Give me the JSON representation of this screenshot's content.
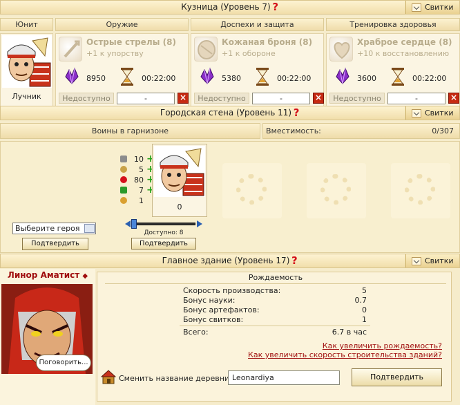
{
  "smithy": {
    "title": "Кузница (Уровень 7)",
    "scrolls": "Свитки",
    "columns": {
      "unit": "Юнит",
      "weapons": "Оружие",
      "armor": "Доспехи и защита",
      "health": "Тренировка здоровья"
    },
    "unit_name": "Лучник",
    "cards": [
      {
        "name": "Острые стрелы (8)",
        "desc": "+1 к упорству",
        "cost": "8950",
        "time": "00:22:00",
        "status": "Недоступно",
        "select": "-"
      },
      {
        "name": "Кожаная броня (8)",
        "desc": "+1 к обороне",
        "cost": "5380",
        "time": "00:22:00",
        "status": "Недоступно",
        "select": "-"
      },
      {
        "name": "Храброе сердце (8)",
        "desc": "+10 к восстановлению",
        "cost": "3600",
        "time": "00:22:00",
        "status": "Недоступно",
        "select": "-"
      }
    ]
  },
  "wall": {
    "title": "Городская стена (Уровень 11)",
    "scrolls": "Свитки",
    "garrison": "Воины в гарнизоне",
    "capacity_label": "Вместимость:",
    "capacity": "0/307",
    "stats": [
      "10",
      "5",
      "80",
      "7",
      "1"
    ],
    "unit_count": "0",
    "hero_select": "Выберите героя",
    "confirm": "Подтвердить",
    "available": "Доступно: 8",
    "confirm2": "Подтвердить"
  },
  "main": {
    "title": "Главное здание (Уровень 17)",
    "scrolls": "Свитки",
    "governor": "Линор Аматист",
    "talk": "Поговорить...",
    "birth_title": "Рождаемость",
    "rows": [
      {
        "k": "Скорость производства:",
        "v": "5"
      },
      {
        "k": "Бонус науки:",
        "v": "0.7"
      },
      {
        "k": "Бонус артефактов:",
        "v": "0"
      },
      {
        "k": "Бонус свитков:",
        "v": "1"
      }
    ],
    "total_label": "Всего:",
    "total": "6.7 в час",
    "link1": "Как увеличить рождаемость?",
    "link2": "Как увеличить скорость строительства зданий?",
    "rename_label": "Сменить название деревни:",
    "village": "Leonardiya",
    "confirm": "Подтвердить"
  },
  "colors": {
    "accent": "#d4101a",
    "bg": "#f6eccb",
    "link": "#a01010"
  }
}
